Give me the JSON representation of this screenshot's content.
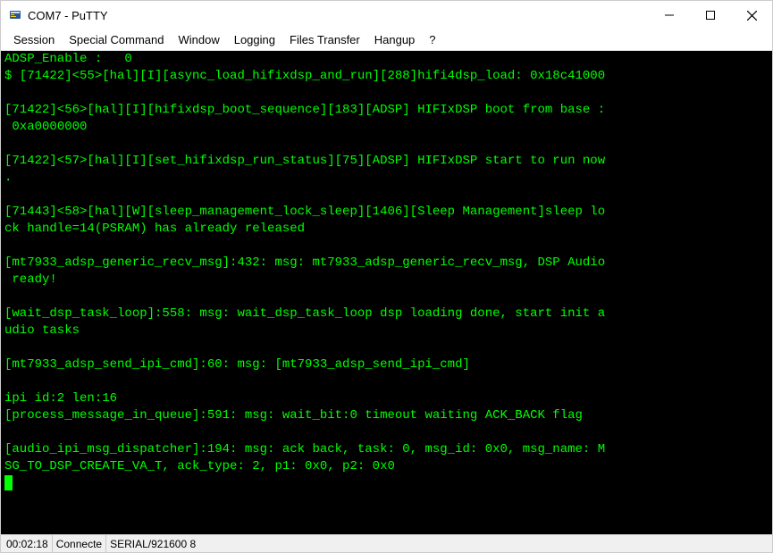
{
  "window": {
    "title": "COM7 - PuTTY"
  },
  "menu": {
    "session": "Session",
    "special": "Special Command",
    "window": "Window",
    "logging": "Logging",
    "files": "Files Transfer",
    "hangup": "Hangup",
    "help": "?"
  },
  "terminal": {
    "content": "ADSP_Enable :   0\n$ [71422]<55>[hal][I][async_load_hifixdsp_and_run][288]hifi4dsp_load: 0x18c41000\n\n[71422]<56>[hal][I][hifixdsp_boot_sequence][183][ADSP] HIFIxDSP boot from base :\n 0xa0000000\n\n[71422]<57>[hal][I][set_hifixdsp_run_status][75][ADSP] HIFIxDSP start to run now\n.\n\n[71443]<58>[hal][W][sleep_management_lock_sleep][1406][Sleep Management]sleep lo\nck handle=14(PSRAM) has already released\n\n[mt7933_adsp_generic_recv_msg]:432: msg: mt7933_adsp_generic_recv_msg, DSP Audio\n ready!\n\n[wait_dsp_task_loop]:558: msg: wait_dsp_task_loop dsp loading done, start init a\nudio tasks\n\n[mt7933_adsp_send_ipi_cmd]:60: msg: [mt7933_adsp_send_ipi_cmd]\n\nipi id:2 len:16\n[process_message_in_queue]:591: msg: wait_bit:0 timeout waiting ACK_BACK flag\n\n[audio_ipi_msg_dispatcher]:194: msg: ack back, task: 0, msg_id: 0x0, msg_name: M\nSG_TO_DSP_CREATE_VA_T, ack_type: 2, p1: 0x0, p2: 0x0\n"
  },
  "status": {
    "time": "00:02:18",
    "connected": "Connecte",
    "serial": "SERIAL/921600 8"
  }
}
